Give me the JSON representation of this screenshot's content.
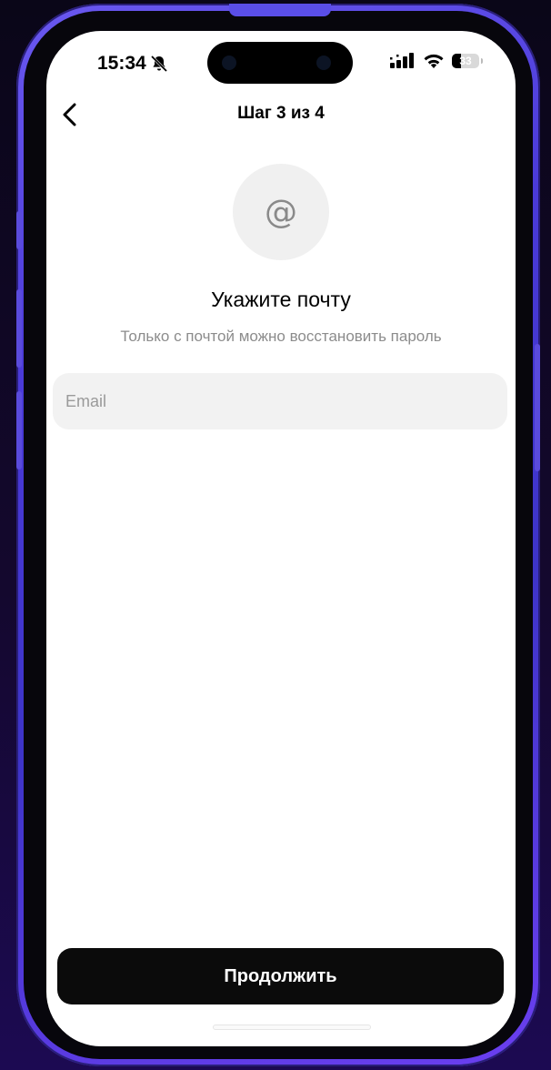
{
  "status_bar": {
    "time": "15:34",
    "battery": "33",
    "icons": [
      "bell-slash-icon",
      "signal-icon",
      "wifi-icon",
      "battery-icon"
    ]
  },
  "nav": {
    "back_icon": "chevron-left-icon",
    "title": "Шаг 3 из 4"
  },
  "header": {
    "icon": "@",
    "title": "Укажите почту",
    "subtitle": "Только с почтой можно восстановить пароль"
  },
  "form": {
    "email_placeholder": "Email",
    "email_value": ""
  },
  "footer": {
    "continue_label": "Продолжить"
  },
  "colors": {
    "accent": "#0b0b0b",
    "input_bg": "#f2f2f2",
    "frame": "#4a3ad8"
  }
}
